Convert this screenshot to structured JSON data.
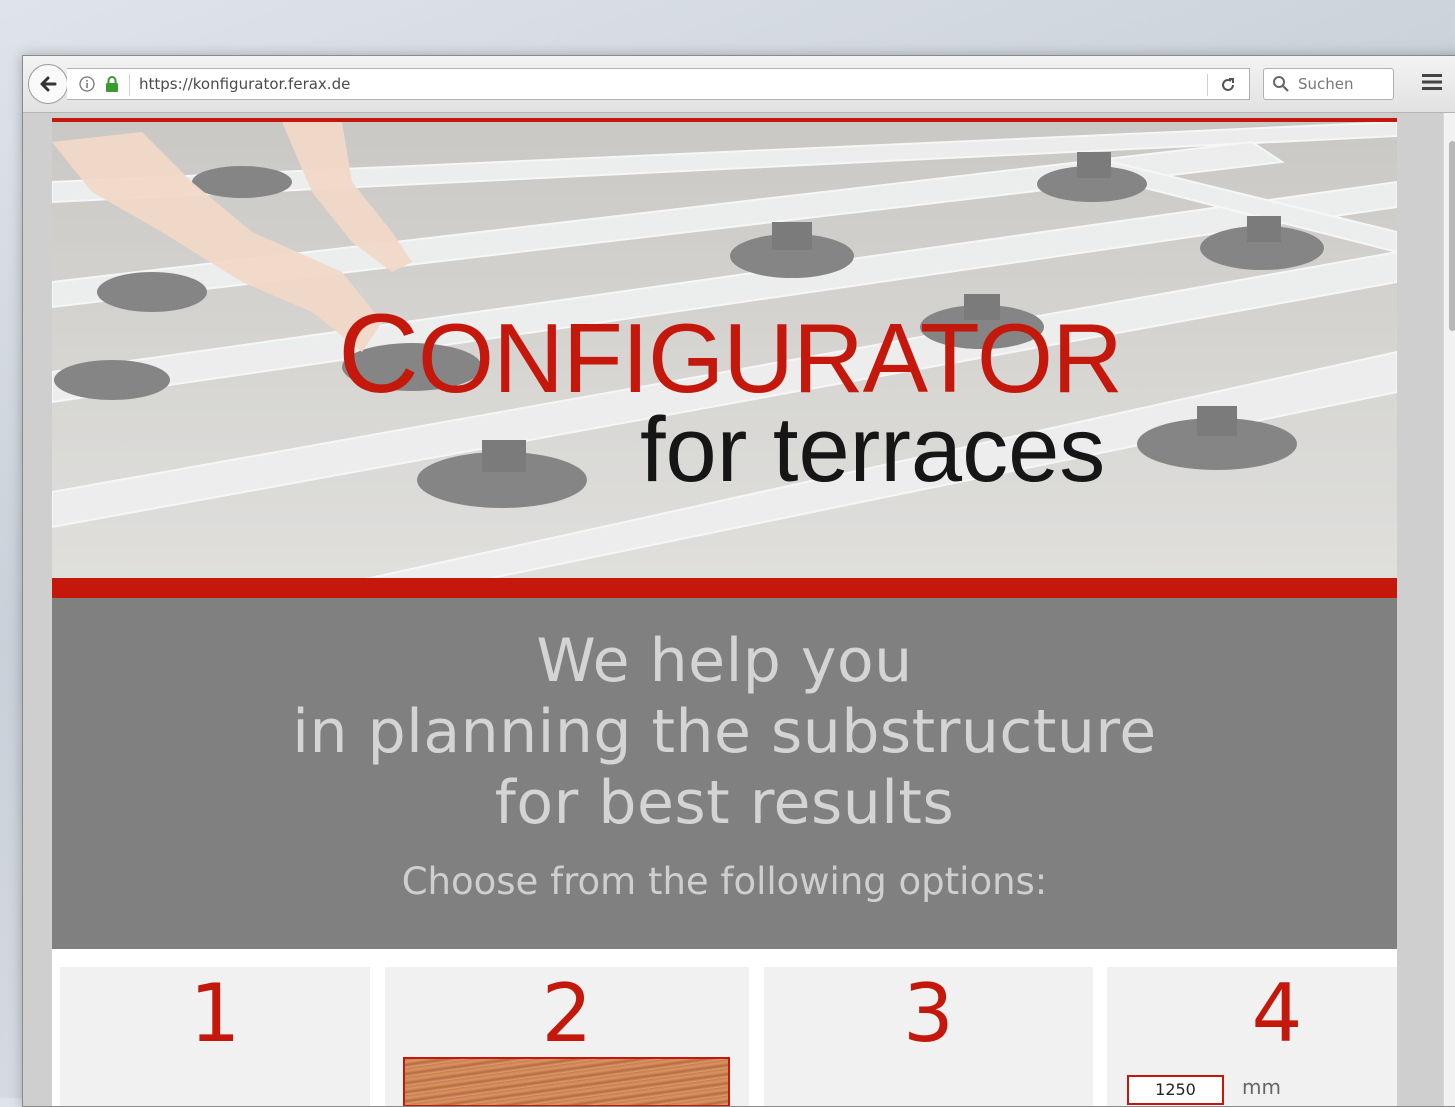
{
  "browser": {
    "url": "https://konfigurator.ferax.de",
    "search_placeholder": "Suchen"
  },
  "hero": {
    "title_first": "C",
    "title_rest": "ONFIGURATOR",
    "subtitle": "for terraces"
  },
  "intro": {
    "line1": "We help you",
    "line2": "in planning the substructure",
    "line3": "for best results",
    "choose": "Choose from the following options:"
  },
  "options": [
    {
      "number": "1"
    },
    {
      "number": "2"
    },
    {
      "number": "3"
    },
    {
      "number": "4",
      "dimension_value": "1250",
      "dimension_unit": "mm"
    }
  ],
  "colors": {
    "brand_red": "#c4180c",
    "panel_gray": "#808080"
  }
}
